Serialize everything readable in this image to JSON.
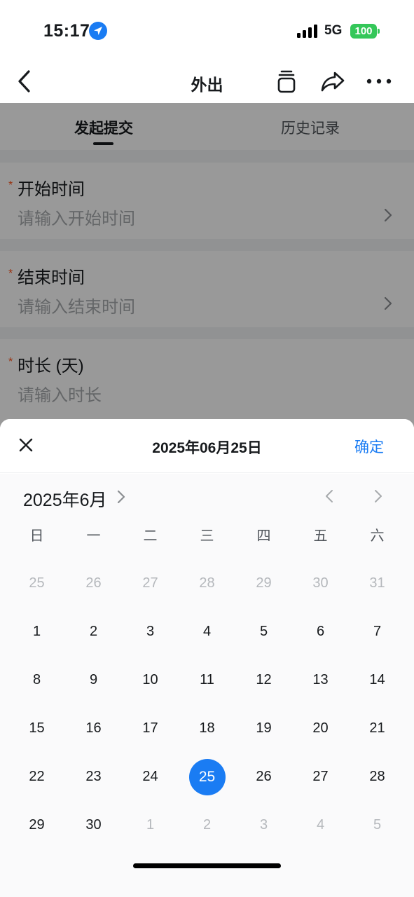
{
  "status_bar": {
    "time": "15:17",
    "network": "5G",
    "battery": "100",
    "icons": [
      "location-arrow-icon",
      "signal-icon",
      "battery-icon"
    ]
  },
  "navbar": {
    "title": "外出",
    "icons": [
      "back-chevron-icon",
      "copy-icon",
      "share-icon",
      "more-icon"
    ]
  },
  "tabs": {
    "active": "发起提交",
    "inactive": "历史记录"
  },
  "fields": [
    {
      "required_mark": "*",
      "label": "开始时间",
      "placeholder": "请输入开始时间"
    },
    {
      "required_mark": "*",
      "label": "结束时间",
      "placeholder": "请输入结束时间"
    },
    {
      "required_mark": "*",
      "label": "时长 (天)",
      "placeholder": "请输入时长"
    }
  ],
  "picker": {
    "title": "2025年06月25日",
    "confirm_label": "确定",
    "month_label": "2025年6月",
    "weekdays": [
      "日",
      "一",
      "二",
      "三",
      "四",
      "五",
      "六"
    ],
    "weeks": [
      [
        "25",
        "26",
        "27",
        "28",
        "29",
        "30",
        "31"
      ],
      [
        "1",
        "2",
        "3",
        "4",
        "5",
        "6",
        "7"
      ],
      [
        "8",
        "9",
        "10",
        "11",
        "12",
        "13",
        "14"
      ],
      [
        "15",
        "16",
        "17",
        "18",
        "19",
        "20",
        "21"
      ],
      [
        "22",
        "23",
        "24",
        "25",
        "26",
        "27",
        "28"
      ],
      [
        "29",
        "30",
        "1",
        "2",
        "3",
        "4",
        "5"
      ]
    ],
    "selected_day": "25"
  },
  "colors": {
    "accent": "#1a7cf3",
    "required": "#ff5219",
    "battery": "#34c759",
    "text": "#171a1d",
    "muted": "#b5b8bc"
  }
}
